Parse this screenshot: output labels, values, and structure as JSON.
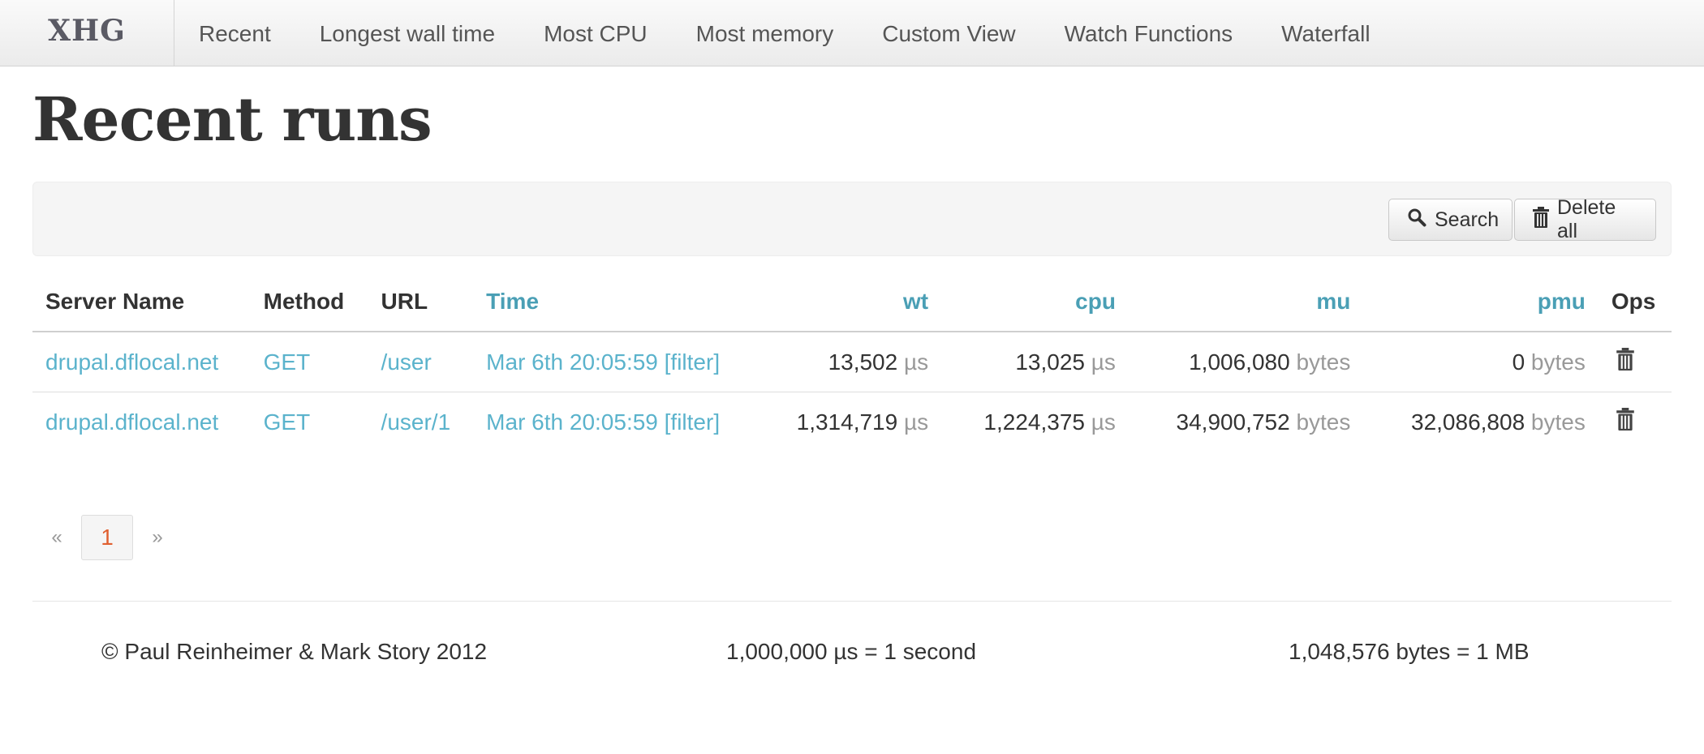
{
  "nav": {
    "brand": "XHG",
    "items": [
      "Recent",
      "Longest wall time",
      "Most CPU",
      "Most memory",
      "Custom View",
      "Watch Functions",
      "Waterfall"
    ]
  },
  "page": {
    "title": "Recent runs"
  },
  "toolbar": {
    "search_label": "Search",
    "delete_all_label": "Delete all"
  },
  "table": {
    "headers": {
      "server_name": "Server Name",
      "method": "Method",
      "url": "URL",
      "time": "Time",
      "wt": "wt",
      "cpu": "cpu",
      "mu": "mu",
      "pmu": "pmu",
      "ops": "Ops"
    },
    "time_unit": "µs",
    "bytes_unit": "bytes",
    "rows": [
      {
        "server": "drupal.dflocal.net",
        "method": "GET",
        "url": "/user",
        "time": "Mar 6th 20:05:59",
        "filter": "[filter]",
        "wt": "13,502",
        "cpu": "13,025",
        "mu": "1,006,080",
        "pmu": "0"
      },
      {
        "server": "drupal.dflocal.net",
        "method": "GET",
        "url": "/user/1",
        "time": "Mar 6th 20:05:59",
        "filter": "[filter]",
        "wt": "1,314,719",
        "cpu": "1,224,375",
        "mu": "34,900,752",
        "pmu": "32,086,808"
      }
    ]
  },
  "pagination": {
    "prev": "«",
    "current": "1",
    "next": "»"
  },
  "footer": {
    "copyright": "© Paul Reinheimer & Mark Story 2012",
    "time_note": "1,000,000 µs = 1 second",
    "bytes_note": "1,048,576 bytes = 1 MB"
  },
  "colors": {
    "link": "#5bb3cc",
    "sortable_header": "#4a9fb5",
    "active_page": "#e06030",
    "unit_gray": "#999999"
  },
  "icons": {
    "search": "search-icon",
    "trash": "trash-icon"
  }
}
